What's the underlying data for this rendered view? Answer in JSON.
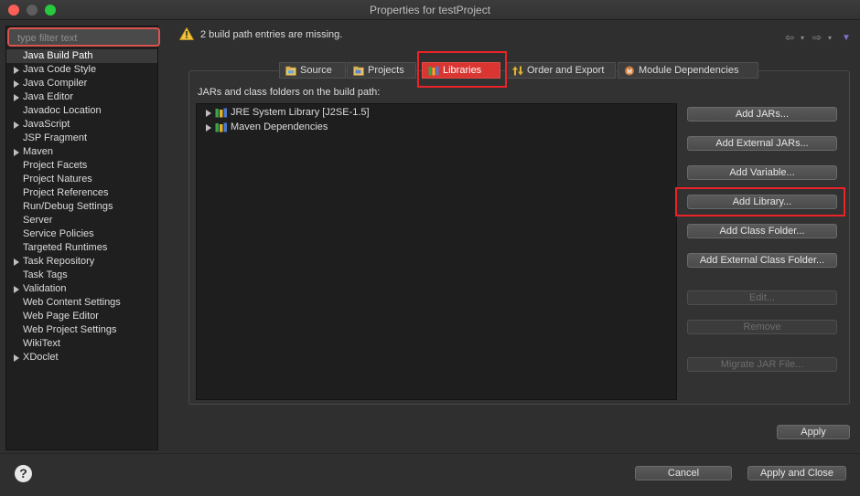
{
  "window": {
    "title": "Properties for testProject"
  },
  "filter": {
    "placeholder": "type filter text"
  },
  "sidebar": {
    "items": [
      {
        "label": "Java Build Path",
        "expandable": false,
        "selected": true
      },
      {
        "label": "Java Code Style",
        "expandable": true
      },
      {
        "label": "Java Compiler",
        "expandable": true
      },
      {
        "label": "Java Editor",
        "expandable": true
      },
      {
        "label": "Javadoc Location",
        "expandable": false
      },
      {
        "label": "JavaScript",
        "expandable": true
      },
      {
        "label": "JSP Fragment",
        "expandable": false
      },
      {
        "label": "Maven",
        "expandable": true
      },
      {
        "label": "Project Facets",
        "expandable": false
      },
      {
        "label": "Project Natures",
        "expandable": false
      },
      {
        "label": "Project References",
        "expandable": false
      },
      {
        "label": "Run/Debug Settings",
        "expandable": false
      },
      {
        "label": "Server",
        "expandable": false
      },
      {
        "label": "Service Policies",
        "expandable": false
      },
      {
        "label": "Targeted Runtimes",
        "expandable": false
      },
      {
        "label": "Task Repository",
        "expandable": true
      },
      {
        "label": "Task Tags",
        "expandable": false
      },
      {
        "label": "Validation",
        "expandable": true
      },
      {
        "label": "Web Content Settings",
        "expandable": false
      },
      {
        "label": "Web Page Editor",
        "expandable": false
      },
      {
        "label": "Web Project Settings",
        "expandable": false
      },
      {
        "label": "WikiText",
        "expandable": false
      },
      {
        "label": "XDoclet",
        "expandable": true
      }
    ]
  },
  "message": {
    "text": "2 build path entries are missing.",
    "icon": "warning-icon"
  },
  "tabs": [
    {
      "label": "Source",
      "icon": "source-folder-icon"
    },
    {
      "label": "Projects",
      "icon": "projects-icon"
    },
    {
      "label": "Libraries",
      "icon": "libraries-icon",
      "active": true
    },
    {
      "label": "Order and Export",
      "icon": "order-export-icon"
    },
    {
      "label": "Module Dependencies",
      "icon": "module-icon"
    }
  ],
  "build_path": {
    "label": "JARs and class folders on the build path:",
    "entries": [
      {
        "label": "JRE System Library [J2SE-1.5]",
        "icon": "library-icon"
      },
      {
        "label": "Maven Dependencies",
        "icon": "library-icon"
      }
    ]
  },
  "buttons": {
    "add_jars": "Add JARs...",
    "add_external_jars": "Add External JARs...",
    "add_variable": "Add Variable...",
    "add_library": "Add Library...",
    "add_class_folder": "Add Class Folder...",
    "add_external_class_folder": "Add External Class Folder...",
    "edit": "Edit...",
    "remove": "Remove",
    "migrate_jar": "Migrate JAR File...",
    "apply": "Apply",
    "cancel": "Cancel",
    "apply_close": "Apply and Close"
  },
  "colors": {
    "highlight": "#ea2329",
    "active_tab": "#d93632"
  }
}
